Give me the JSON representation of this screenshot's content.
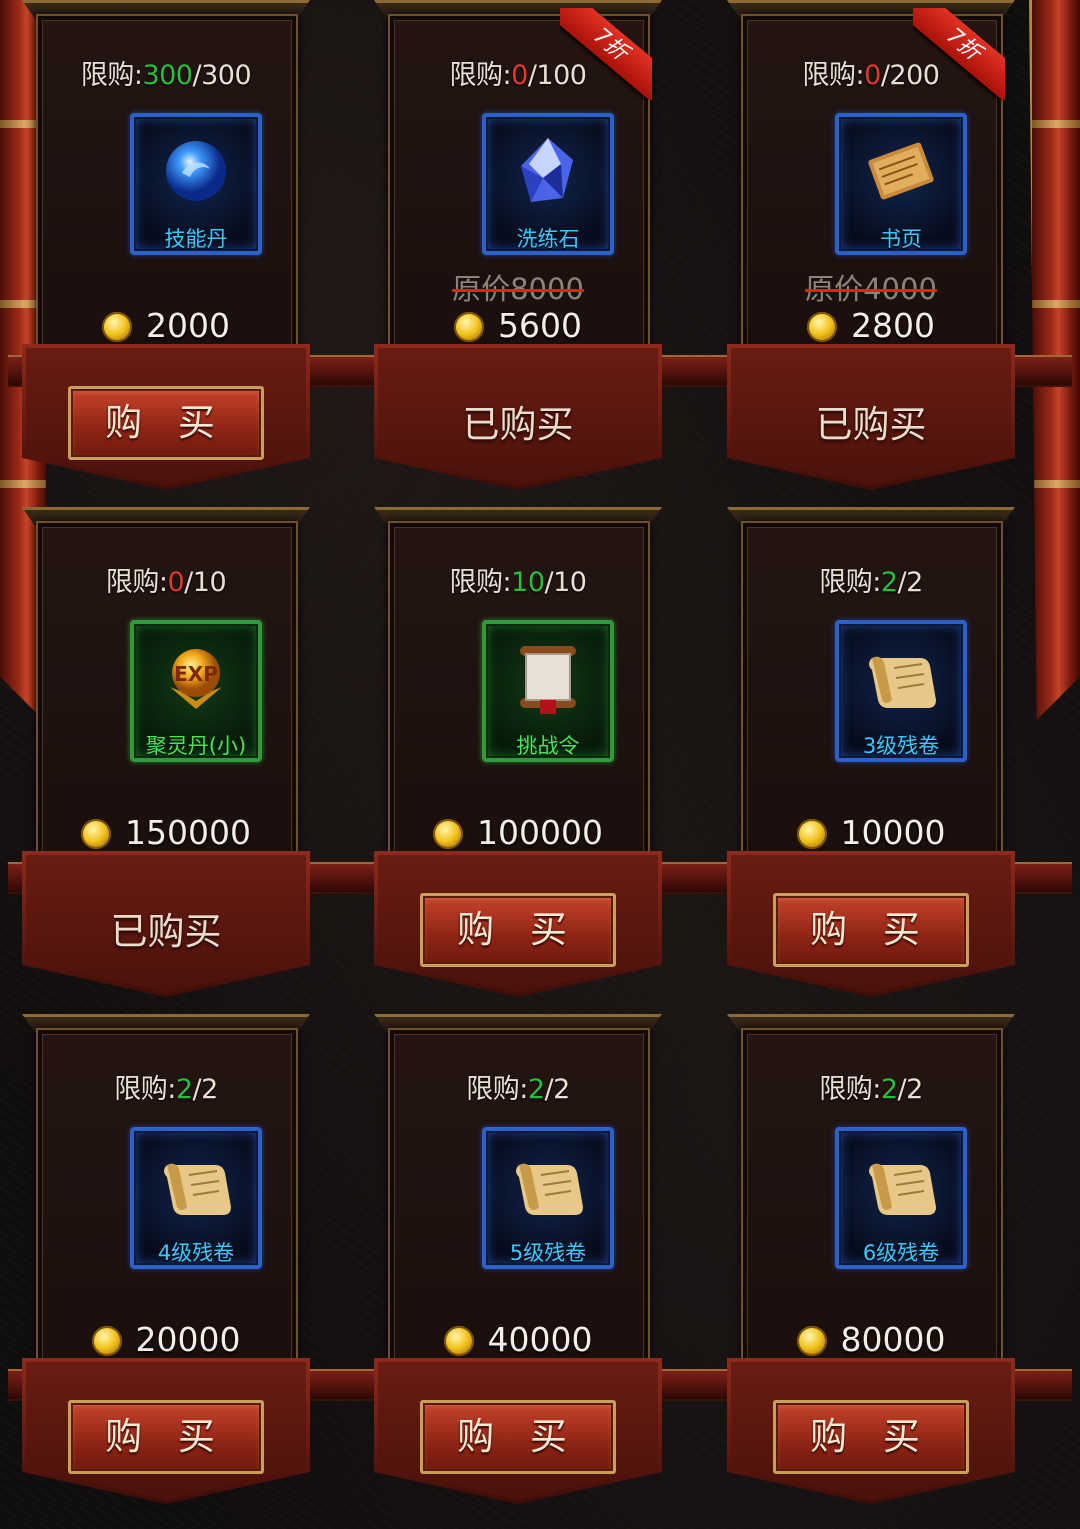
{
  "limit_prefix": "限购:",
  "buy_label": "购 买",
  "bought_label": "已购买",
  "items": [
    {
      "name": "技能丹",
      "limit_current": "300",
      "limit_total": "/300",
      "limit_color": "green",
      "price": "2000",
      "original_price": "",
      "discount": "",
      "box": "blue",
      "icon": "blue-orb-icon",
      "bought": false
    },
    {
      "name": "洗练石",
      "limit_current": "0",
      "limit_total": "/100",
      "limit_color": "red",
      "price": "5600",
      "original_price": "原价8000",
      "discount": "7折",
      "box": "blue",
      "icon": "crystal-icon",
      "bought": true
    },
    {
      "name": "书页",
      "limit_current": "0",
      "limit_total": "/200",
      "limit_color": "red",
      "price": "2800",
      "original_price": "原价4000",
      "discount": "7折",
      "box": "blue",
      "icon": "book-page-icon",
      "bought": true
    },
    {
      "name": "聚灵丹(小)",
      "limit_current": "0",
      "limit_total": "/10",
      "limit_color": "red",
      "price": "150000",
      "original_price": "",
      "discount": "",
      "box": "green",
      "icon": "exp-orb-icon",
      "bought": true
    },
    {
      "name": "挑战令",
      "limit_current": "10",
      "limit_total": "/10",
      "limit_color": "green",
      "price": "100000",
      "original_price": "",
      "discount": "",
      "box": "green",
      "icon": "challenge-scroll-icon",
      "bought": false
    },
    {
      "name": "3级残卷",
      "limit_current": "2",
      "limit_total": "/2",
      "limit_color": "green",
      "price": "10000",
      "original_price": "",
      "discount": "",
      "box": "blue",
      "icon": "scroll-icon",
      "bought": false
    },
    {
      "name": "4级残卷",
      "limit_current": "2",
      "limit_total": "/2",
      "limit_color": "green",
      "price": "20000",
      "original_price": "",
      "discount": "",
      "box": "blue",
      "icon": "scroll-icon",
      "bought": false
    },
    {
      "name": "5级残卷",
      "limit_current": "2",
      "limit_total": "/2",
      "limit_color": "green",
      "price": "40000",
      "original_price": "",
      "discount": "",
      "box": "blue",
      "icon": "scroll-icon",
      "bought": false
    },
    {
      "name": "6级残卷",
      "limit_current": "2",
      "limit_total": "/2",
      "limit_color": "green",
      "price": "80000",
      "original_price": "",
      "discount": "",
      "box": "blue",
      "icon": "scroll-icon",
      "bought": false
    }
  ],
  "colors": {
    "limit_green": "#26c03a",
    "limit_red": "#e23a2a",
    "name_blue": "#3cc8ff",
    "name_green": "#49e45a"
  }
}
